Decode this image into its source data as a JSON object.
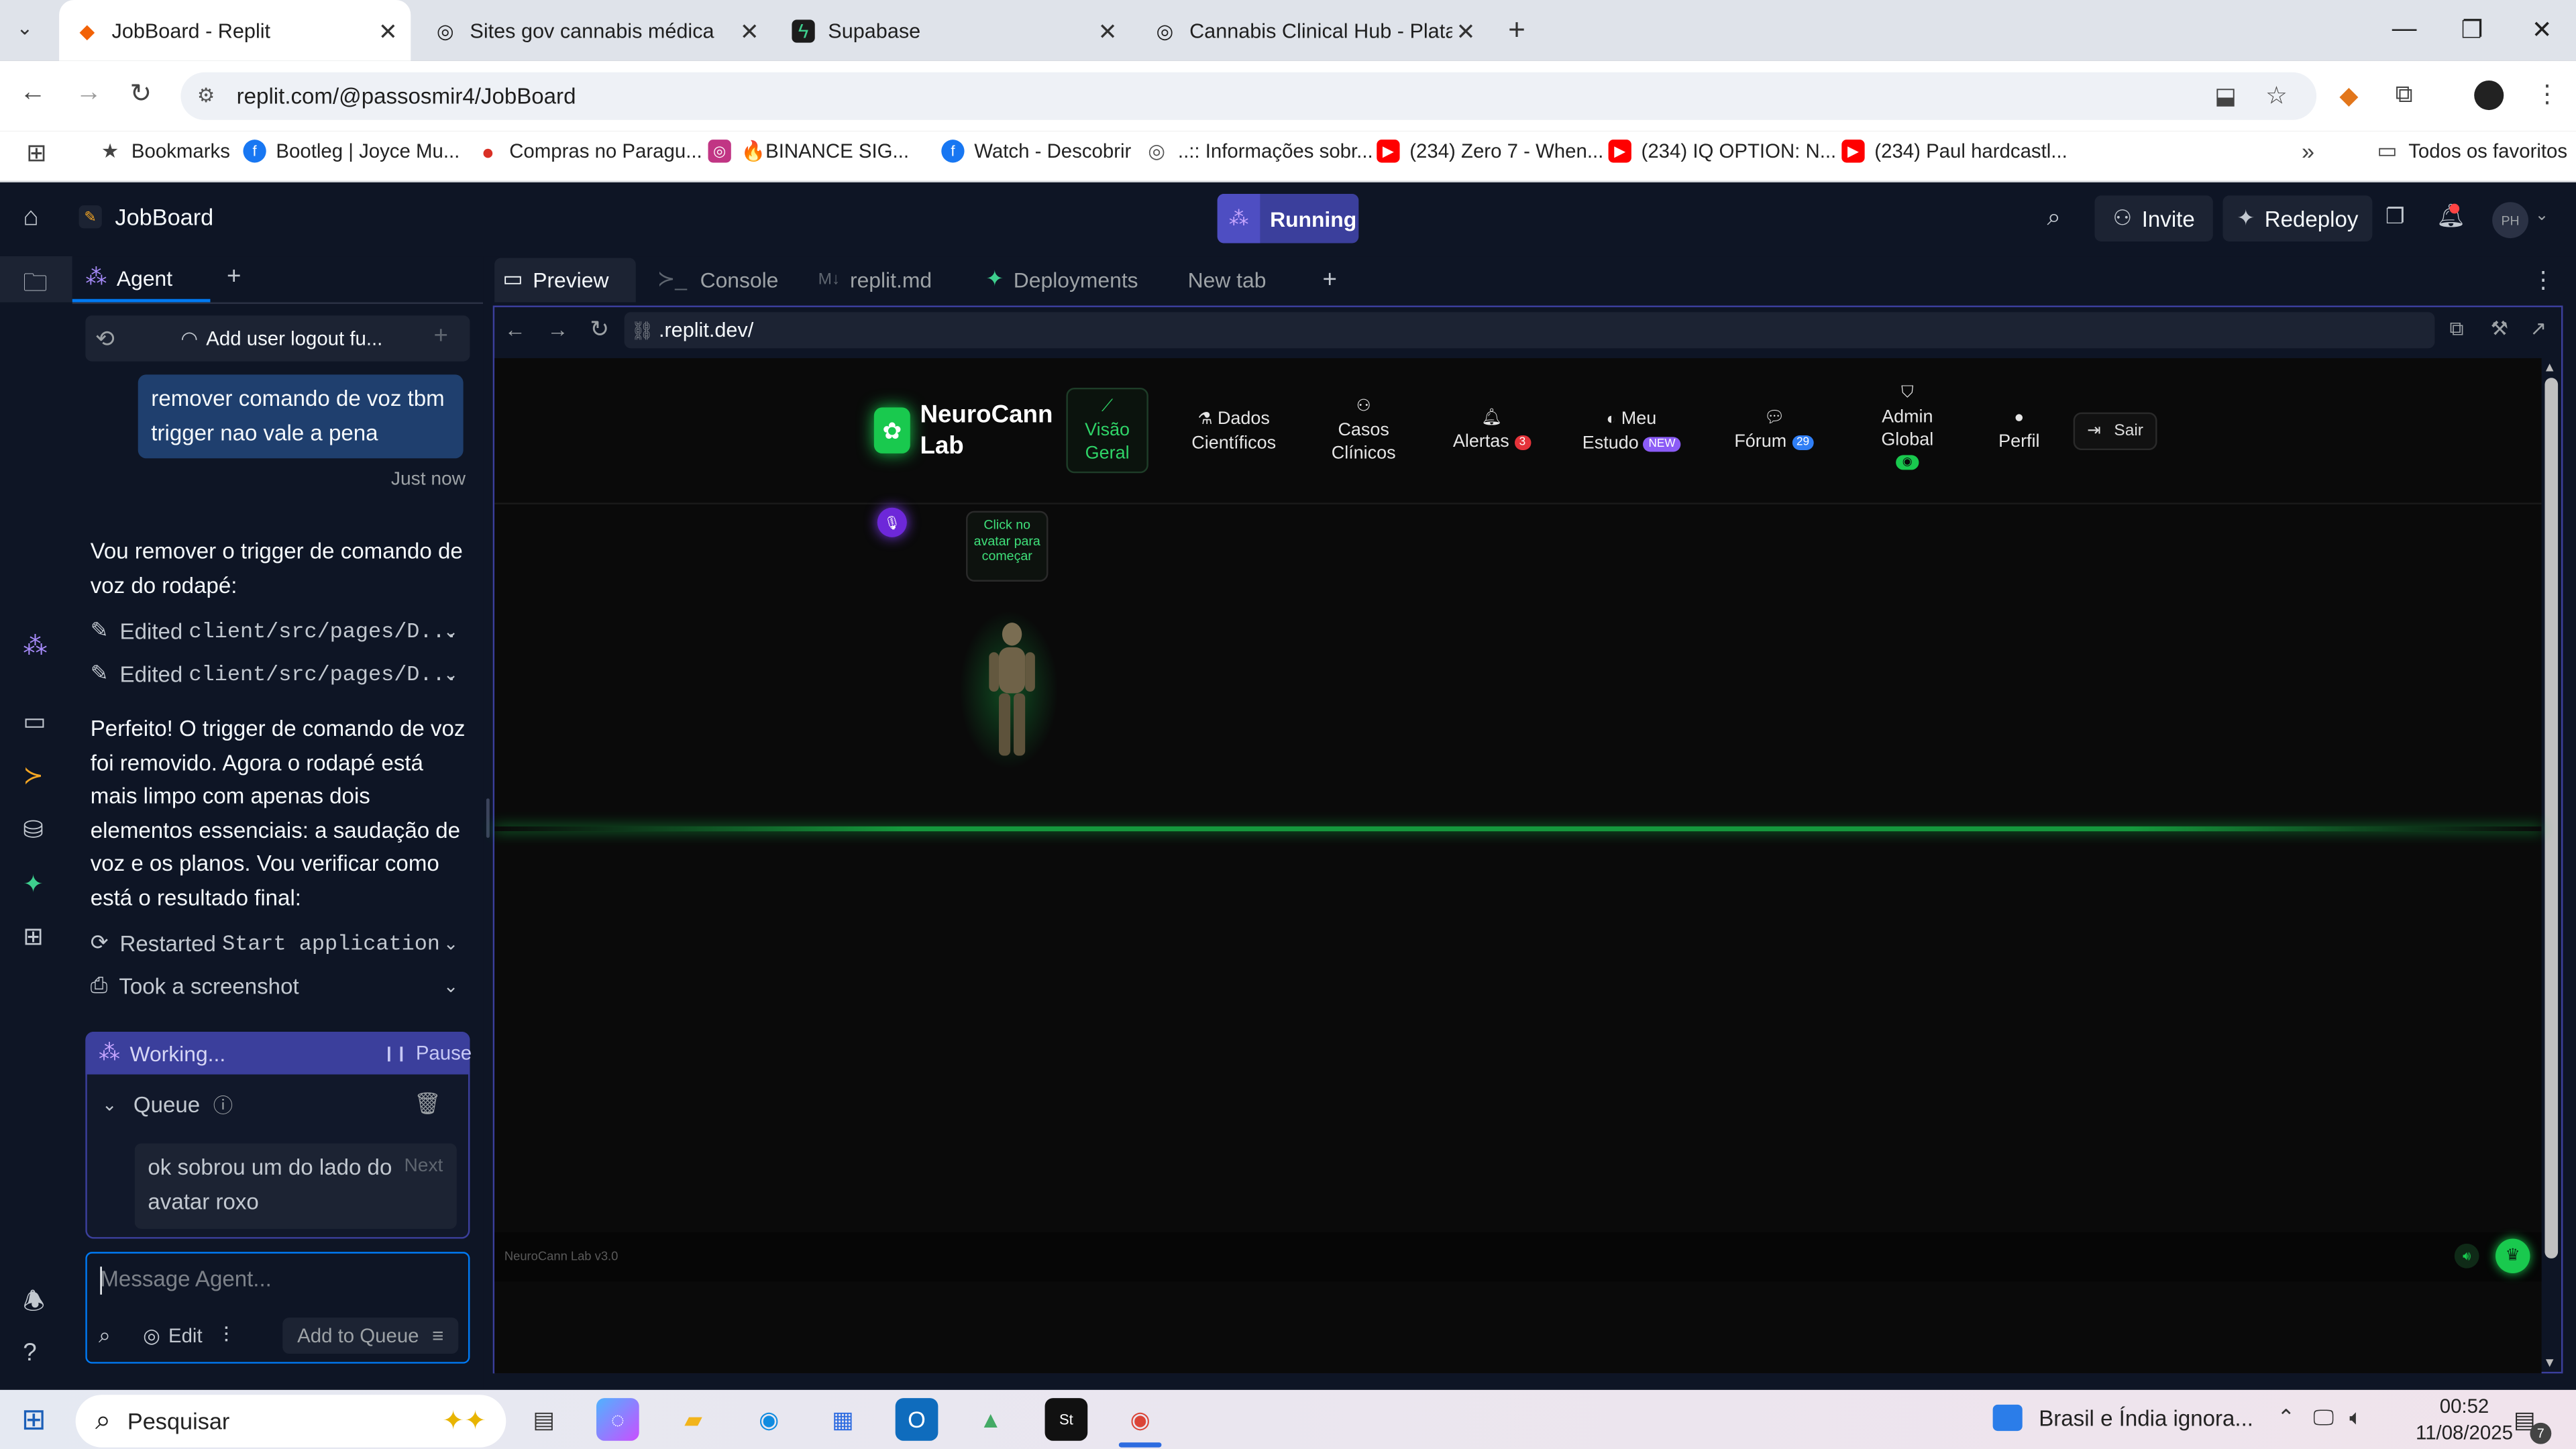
{
  "browser": {
    "tabs": [
      {
        "title": "JobBoard - Replit",
        "active": true
      },
      {
        "title": "Sites gov cannabis médica"
      },
      {
        "title": "Supabase"
      },
      {
        "title": "Cannabis Clinical Hub - Platafo"
      }
    ],
    "url": "replit.com/@passosmir4/JobBoard",
    "bookmarks": [
      "Bookmarks",
      "Bootleg | Joyce Mu...",
      "Compras no Paragu...",
      "🔥BINANCE SIG...",
      "Watch - Descobrir",
      "..:: Informações sobr...",
      "(234) Zero 7 - When...",
      "(234) IQ OPTION: N...",
      "(234) Paul hardcastl..."
    ],
    "all_bookmarks": "Todos os favoritos"
  },
  "replit": {
    "project": "JobBoard",
    "status": "Running",
    "invite": "Invite",
    "redeploy": "Redeploy",
    "avatar": "PH",
    "agent_tab": "Agent",
    "checkpoint": "Add user logout fu...",
    "user_message": "remover comando de voz tbm trigger nao vale a pena",
    "user_time": "Just now",
    "agent_intro": "Vou remover o trigger de comando de voz do rodapé:",
    "edit1_label": "Edited",
    "edit1_path": "client/src/pages/D...",
    "edit2_label": "Edited",
    "edit2_path": "client/src/pages/D...",
    "agent_reply": "Perfeito! O trigger de comando de voz foi removido. Agora o rodapé está mais limpo com apenas dois elementos essenciais: a saudação de voz e os planos. Vou verificar como está o resultado final:",
    "restart_label": "Restarted",
    "restart_code": "Start application",
    "screenshot_label": "Took a screenshot",
    "working": "Working...",
    "pause": "Pause",
    "queue": "Queue",
    "queued_message": "ok sobrou um do lado do avatar roxo",
    "next": "Next",
    "message_placeholder": "Message Agent...",
    "edit_btn": "Edit",
    "add_queue": "Add to Queue",
    "panel_tabs": [
      "Preview",
      "Console",
      "replit.md",
      "Deployments",
      "New tab"
    ],
    "preview_url": ".replit.dev/"
  },
  "app": {
    "logo": "NeuroCann Lab",
    "nav": [
      {
        "label": "Visão Geral"
      },
      {
        "label": "Dados Científicos"
      },
      {
        "label": "Casos Clínicos"
      },
      {
        "label": "Alertas",
        "badge": "3"
      },
      {
        "label": "Meu Estudo",
        "badge": "NEW"
      },
      {
        "label": "Fórum",
        "badge": "29"
      },
      {
        "label": "Admin Global"
      },
      {
        "label": "Perfil"
      }
    ],
    "logout": "Sair",
    "avatar_hint": "Click no avatar para começar",
    "footer_version": "NeuroCann Lab v3.0"
  },
  "taskbar": {
    "search": "Pesquisar",
    "news": "Brasil e Índia ignora...",
    "time": "00:52",
    "date": "11/08/2025",
    "notif_count": "7"
  }
}
